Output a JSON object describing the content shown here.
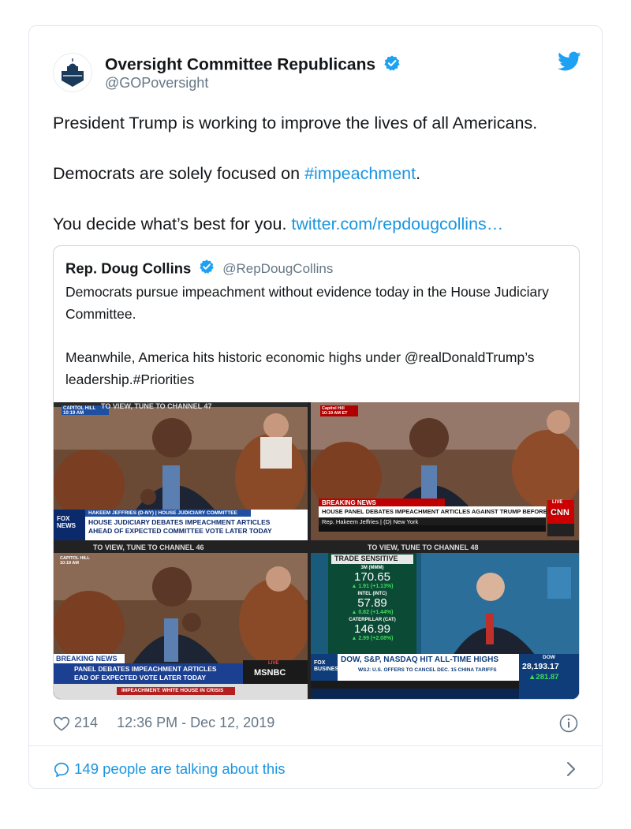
{
  "tweet": {
    "author_name": "Oversight Committee Republicans",
    "author_handle": "@GOPoversight",
    "paragraphs": {
      "p1": "President Trump is working to improve the lives of all Americans.",
      "p2_prefix": "Democrats are solely focused on ",
      "p2_hashtag": "#impeachment",
      "p2_suffix": ".",
      "p3_prefix": "You decide what’s best for you. ",
      "p3_link": "twitter.com/repdougcollins…"
    },
    "likes": "214",
    "timestamp": "12:36 PM - Dec 12, 2019",
    "talking": "149 people are talking about this"
  },
  "quoted_tweet": {
    "author_name": "Rep. Doug Collins",
    "author_handle": "@RepDougCollins",
    "p1": "Democrats pursue impeachment without evidence today in the House Judiciary Committee.",
    "p2": "Meanwhile, America hits historic economic highs under @realDonaldTrump’s leadership.#Priorities"
  },
  "media": {
    "frame1": {
      "top_banner": "TO VIEW, TUNE TO CHANNEL 47",
      "corner": "CAPITOL HILL 10:19 AM",
      "lower_name": "HAKEEM JEFFRIES (D-NY) | HOUSE JUDICIARY COMMITTEE",
      "lower_line1": "HOUSE JUDICIARY DEBATES IMPEACHMENT ARTICLES",
      "lower_line2": "AHEAD OF EXPECTED COMMITTEE VOTE LATER TODAY",
      "logo": "FOX NEWS"
    },
    "frame2": {
      "corner": "Capitol Hill 10:19 AM ET",
      "breaking": "BREAKING NEWS",
      "headline": "HOUSE PANEL DEBATES IMPEACHMENT ARTICLES AGAINST TRUMP BEFORE VOTE",
      "sub": "Rep. Hakeem Jeffries | (D) New York",
      "live": "LIVE",
      "logo": "CNN"
    },
    "frame3": {
      "top_banner": "TO VIEW, TUNE TO CHANNEL 46",
      "corner": "CAPITOL HILL 10:19 AM",
      "breaking": "BREAKING NEWS",
      "lower_line1": "PANEL DEBATES IMPEACHMENT ARTICLES",
      "lower_line2": "EAD OF EXPECTED VOTE LATER TODAY",
      "ticker": "IMPEACHMENT: WHITE HOUSE IN CRISIS",
      "live": "LIVE",
      "logo": "MSNBC"
    },
    "frame4": {
      "top_banner": "TO VIEW, TUNE TO CHANNEL 48",
      "panel_title": "TRADE SENSITIVE",
      "stocks": [
        {
          "name": "3M (MMM)",
          "price": "170.65",
          "change": "1.91 (+1.13%)"
        },
        {
          "name": "INTEL (INTC)",
          "price": "57.89",
          "change": "0.82 (+1.44%)"
        },
        {
          "name": "CATERPILLAR (CAT)",
          "price": "146.99",
          "change": "2.99 (+2.08%)"
        }
      ],
      "headline": "DOW, S&P, NASDAQ HIT ALL-TIME HIGHS",
      "sub": "WSJ: U.S. OFFERS TO CANCEL DEC. 15 CHINA TARIFFS",
      "index_label": "DOW",
      "index_value": "28,193.17",
      "index_change": "281.87",
      "logo": "FOX BUSINESS"
    }
  },
  "colors": {
    "link": "#1b95e0",
    "verified": "#1da1f2",
    "secondary_text": "#657786",
    "border": "#e1e8ed"
  },
  "icons": {
    "bird": "twitter-bird-icon",
    "verified": "verified-badge-icon",
    "like": "heart-icon",
    "info": "info-icon",
    "reply": "speech-bubble-icon",
    "chevron": "chevron-right-icon"
  }
}
